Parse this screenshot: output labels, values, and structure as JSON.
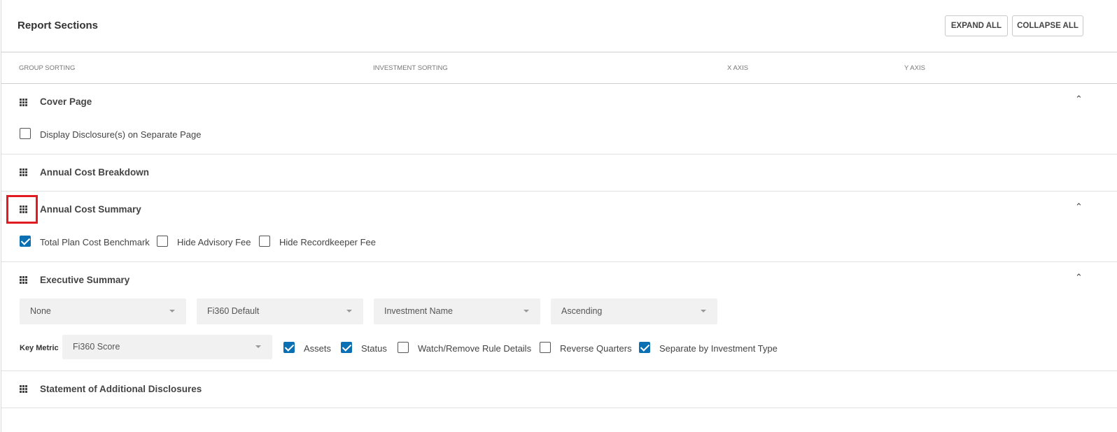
{
  "header": {
    "title": "Report Sections",
    "expand_all": "EXPAND ALL",
    "collapse_all": "COLLAPSE ALL"
  },
  "columns": {
    "group_sorting": "GROUP SORTING",
    "investment_sorting": "INVESTMENT SORTING",
    "x_axis": "X AXIS",
    "y_axis": "Y AXIS"
  },
  "sections": {
    "cover_page": {
      "title": "Cover Page",
      "expanded": true,
      "option_label": "Display Disclosure(s) on Separate Page",
      "option_checked": false
    },
    "annual_cost_breakdown": {
      "title": "Annual Cost Breakdown",
      "expanded": false
    },
    "annual_cost_summary": {
      "title": "Annual Cost Summary",
      "expanded": true,
      "options": [
        {
          "label": "Total Plan Cost Benchmark",
          "checked": true
        },
        {
          "label": "Hide Advisory Fee",
          "checked": false
        },
        {
          "label": "Hide Recordkeeper Fee",
          "checked": false
        }
      ]
    },
    "executive_summary": {
      "title": "Executive Summary",
      "expanded": true,
      "group_sorting": "None",
      "investment_sorting": "Fi360 Default",
      "x_axis": "Investment Name",
      "y_axis": "Ascending",
      "key_metric_label": "Key Metric",
      "key_metric_value": "Fi360 Score",
      "options": [
        {
          "label": "Assets",
          "checked": true
        },
        {
          "label": "Status",
          "checked": true
        },
        {
          "label": "Watch/Remove Rule Details",
          "checked": false
        },
        {
          "label": "Reverse Quarters",
          "checked": false
        },
        {
          "label": "Separate by Investment Type",
          "checked": true
        }
      ]
    },
    "additional_disclosures": {
      "title": "Statement of Additional Disclosures",
      "expanded": false
    }
  },
  "icons": {
    "drag_handle": "grip-icon",
    "expanded": "chevron-up-icon",
    "dropdown": "caret-down-icon"
  },
  "colors": {
    "accent": "#0b6fb3",
    "highlight": "#e11b22"
  }
}
